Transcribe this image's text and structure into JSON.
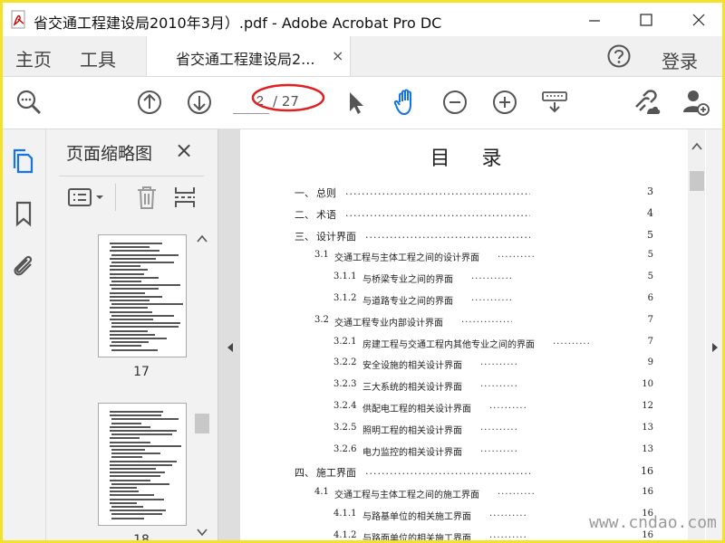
{
  "window": {
    "title": "省交通工程建设局2010年3月）.pdf - Adobe Acrobat Pro DC"
  },
  "nav": {
    "home": "主页",
    "tools": "工具",
    "doc_tab": "省交通工程建设局2...",
    "doc_tab_close": "×",
    "login": "登录"
  },
  "toolbar": {
    "page_current": "2",
    "page_total": "/ 27"
  },
  "panel": {
    "title": "页面缩略图",
    "close": "×",
    "thumbnails": [
      {
        "page": "17"
      },
      {
        "page": "18"
      }
    ]
  },
  "document": {
    "toc_title": "目 录",
    "toc": [
      {
        "num": "一、",
        "label": "总则",
        "page": "3",
        "level": 0
      },
      {
        "num": "二、",
        "label": "术语",
        "page": "4",
        "level": 0
      },
      {
        "num": "三、",
        "label": "设计界面",
        "page": "5",
        "level": 0
      },
      {
        "num": "3.1",
        "label": "交通工程与主体工程之间的设计界面",
        "page": "5",
        "level": 1
      },
      {
        "num": "3.1.1",
        "label": "与桥梁专业之间的界面",
        "page": "5",
        "level": 2
      },
      {
        "num": "3.1.2",
        "label": "与道路专业之间的界面",
        "page": "6",
        "level": 2
      },
      {
        "num": "3.2",
        "label": "交通工程专业内部设计界面",
        "page": "7",
        "level": 1
      },
      {
        "num": "3.2.1",
        "label": "房建工程与交通工程内其他专业之间的界面",
        "page": "7",
        "level": 2
      },
      {
        "num": "3.2.2",
        "label": "安全设施的相关设计界面",
        "page": "9",
        "level": 2
      },
      {
        "num": "3.2.3",
        "label": "三大系统的相关设计界面",
        "page": "10",
        "level": 2
      },
      {
        "num": "3.2.4",
        "label": "供配电工程的相关设计界面",
        "page": "12",
        "level": 2
      },
      {
        "num": "3.2.5",
        "label": "照明工程的相关设计界面",
        "page": "13",
        "level": 2
      },
      {
        "num": "3.2.6",
        "label": "电力监控的相关设计界面",
        "page": "13",
        "level": 2
      },
      {
        "num": "四、",
        "label": "施工界面",
        "page": "16",
        "level": 0
      },
      {
        "num": "4.1",
        "label": "交通工程与主体工程之间的施工界面",
        "page": "16",
        "level": 1
      },
      {
        "num": "4.1.1",
        "label": "与路基单位的相关施工界面",
        "page": "16",
        "level": 2
      },
      {
        "num": "4.1.2",
        "label": "与路面单位的相关施工界面",
        "page": "16",
        "level": 2
      }
    ]
  },
  "watermark": "www.cndao.com",
  "colors": {
    "frame": "#f5e12a",
    "accent_blue": "#1473e6",
    "callout": "#e02020"
  },
  "icons": [
    "search-icon",
    "scroll-up-icon",
    "scroll-down-icon",
    "select-cursor-icon",
    "hand-tool-icon",
    "zoom-out-icon",
    "zoom-in-icon",
    "keyboard-icon",
    "share-link-icon",
    "add-user-icon",
    "thumbnails-icon",
    "bookmark-icon",
    "attachment-icon",
    "options-menu-icon",
    "trash-icon",
    "extract-icon",
    "help-icon"
  ]
}
